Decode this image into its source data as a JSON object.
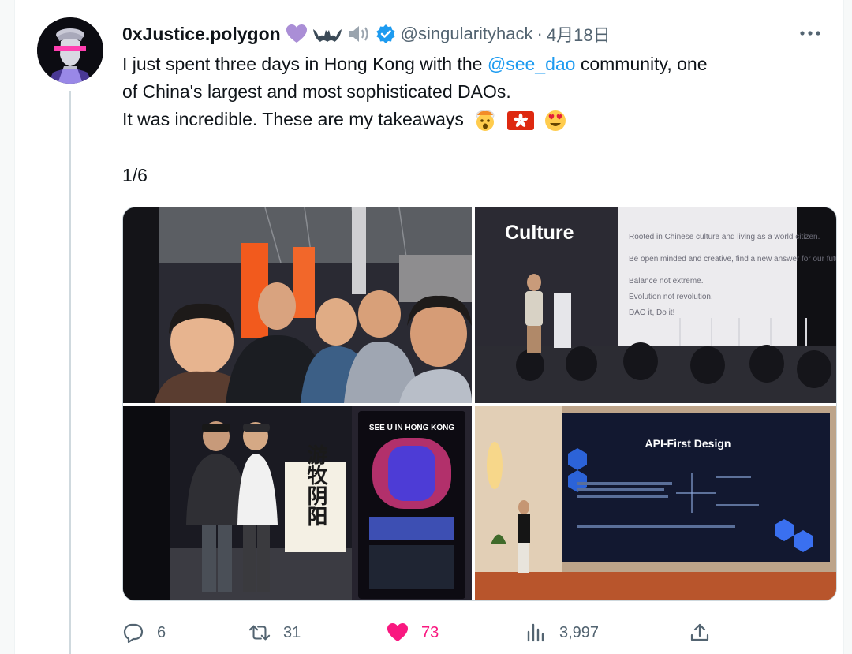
{
  "author": {
    "display_name": "0xJustice.polygon",
    "handle": "@singularityhack",
    "separator": "·",
    "date": "4月18日",
    "badges": [
      "purple-heart-icon",
      "bat-icon",
      "speaker-icon",
      "verified-badge-icon"
    ]
  },
  "tweet": {
    "line1_pre": "I just spent three days in Hong Kong with the ",
    "mention": "@see_dao",
    "line1_post": " community, one",
    "line2": "of China's largest and most sophisticated DAOs.",
    "line3": "It was incredible. These are my takeaways",
    "emojis": [
      "exploding-head-emoji",
      "hong-kong-flag-emoji",
      "heart-eyes-emoji"
    ],
    "page_count": "1/6"
  },
  "media": {
    "top_right_slide_title": "Culture",
    "top_right_slide_bullets": [
      "Rooted in Chinese culture and living as a world citizen.",
      "Be open minded and creative, find a new answer for our future.",
      "Balance not extreme.",
      "Evolution not revolution.",
      "DAO it, Do it!"
    ],
    "bottom_left_poster_title": "SEE U IN HONG KONG",
    "bottom_left_banner_text": "游牧阴阳",
    "bottom_right_slide_title": "API-First Design"
  },
  "actions": {
    "replies": "6",
    "retweets": "31",
    "likes": "73",
    "views": "3,997"
  },
  "colors": {
    "link": "#1d9bf0",
    "like": "#f91880",
    "muted": "#536471",
    "text": "#0f1419"
  }
}
